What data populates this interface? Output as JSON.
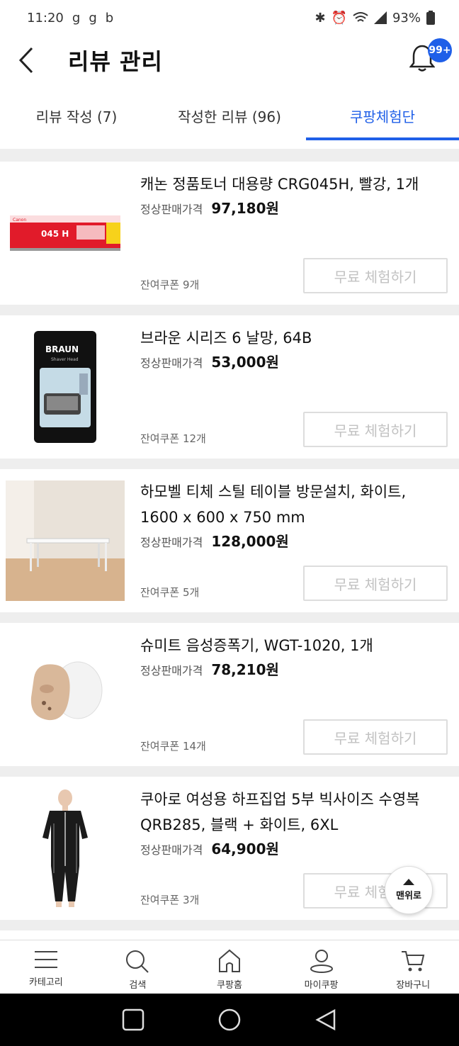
{
  "status_bar": {
    "time": "11:20",
    "battery": "93%",
    "left_icons": [
      "notification-g-icon",
      "notification-g-icon",
      "notification-b-icon"
    ],
    "right_icons": [
      "bluetooth-icon",
      "alarm-icon",
      "wifi-icon",
      "signal-icon",
      "battery-icon"
    ]
  },
  "header": {
    "title": "리뷰 관리",
    "notification_badge": "99+"
  },
  "tabs": [
    {
      "label": "리뷰 작성 (7)"
    },
    {
      "label": "작성한 리뷰 (96)"
    },
    {
      "label": "쿠팡체험단",
      "active": true
    }
  ],
  "items": [
    {
      "name": "캐논 정품토너 대용량 CRG045H, 빨강, 1개",
      "price_label": "정상판매가격",
      "price": "97,180원",
      "coupon": "잔여쿠폰 9개",
      "button": "무료 체험하기",
      "image": "toner-box"
    },
    {
      "name": "브라운 시리즈 6 날망, 64B",
      "price_label": "정상판매가격",
      "price": "53,000원",
      "coupon": "잔여쿠폰 12개",
      "button": "무료 체험하기",
      "image": "shaver-head"
    },
    {
      "name": "하모벨 티체 스틸 테이블 방문설치, 화이트, 1600 x 600 x 750 mm",
      "price_label": "정상판매가격",
      "price": "128,000원",
      "coupon": "잔여쿠폰 5개",
      "button": "무료 체험하기",
      "image": "table"
    },
    {
      "name": "슈미트 음성증폭기, WGT-1020, 1개",
      "price_label": "정상판매가격",
      "price": "78,210원",
      "coupon": "잔여쿠폰 14개",
      "button": "무료 체험하기",
      "image": "hearing-amp"
    },
    {
      "name": "쿠아로 여성용 하프집업 5부 빅사이즈 수영복 QRB285, 블랙 + 화이트, 6XL",
      "price_label": "정상판매가격",
      "price": "64,900원",
      "coupon": "잔여쿠폰 3개",
      "button": "무료 체험하기",
      "image": "swimsuit"
    }
  ],
  "scroll_top_button": "맨위로",
  "bottom_nav": [
    {
      "label": "카테고리",
      "icon": "menu-icon"
    },
    {
      "label": "검색",
      "icon": "search-icon"
    },
    {
      "label": "쿠팡홈",
      "icon": "home-icon"
    },
    {
      "label": "마이쿠팡",
      "icon": "user-icon"
    },
    {
      "label": "장바구니",
      "icon": "cart-icon"
    }
  ],
  "colors": {
    "accent": "#1f5fe8",
    "divider": "#eeeeee"
  }
}
